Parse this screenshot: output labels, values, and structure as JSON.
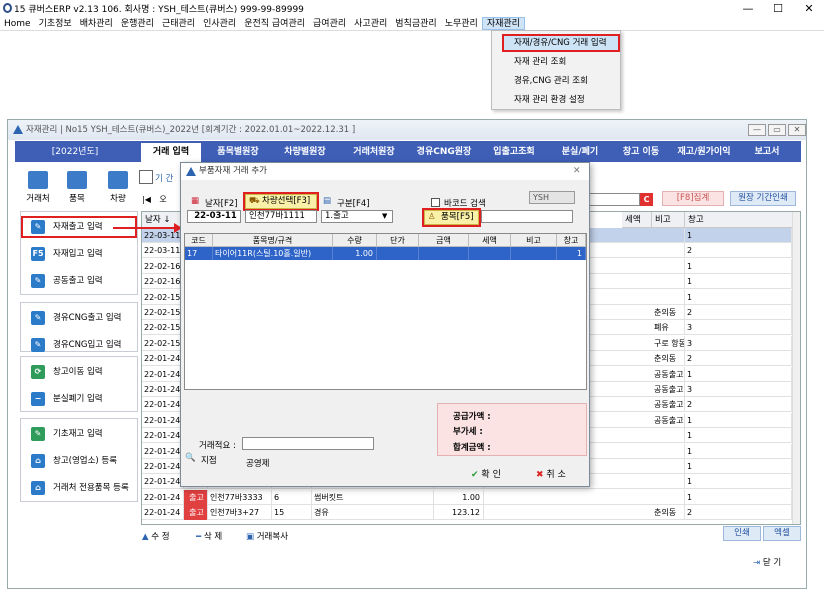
{
  "app": {
    "title": "15 큐버스ERP v2.13  106. 회사명 : YSH_테스트(큐버스)  999-99-89999",
    "window_buttons": [
      "—",
      "☐",
      "✕"
    ]
  },
  "menu": {
    "items": [
      "Home",
      "기초정보",
      "배차관리",
      "운행관리",
      "근태관리",
      "인사관리",
      "운전직 급여관리",
      "급여관리",
      "사고관리",
      "범칙금관리",
      "노무관리",
      "자재관리"
    ],
    "active_index": 11
  },
  "dropdown": {
    "items": [
      "자재/경유/CNG 거래 입력",
      "자재 관리 조회",
      "경유,CNG 관리 조회",
      "자재 관리 환경 설정"
    ],
    "selected_index": 0
  },
  "main_window": {
    "title": "자재관리 | No15 YSH_테스트(큐버스)_2022년 [회계기간 : 2022.01.01~2022.12.31 ]",
    "buttons": [
      "—",
      "▭",
      "✕"
    ],
    "year_label": "[2022년도]",
    "tabs": [
      "거래 입력",
      "품목별원장",
      "차량별원장",
      "거래처원장",
      "경유CNG원장",
      "입출고조회",
      "분실/폐기",
      "창고 이동",
      "재고/원가이익",
      "보고서"
    ],
    "active_tab": 0,
    "toolbar": [
      {
        "label": "거래처",
        "icon": "building-icon"
      },
      {
        "label": "품목",
        "icon": "box-icon"
      },
      {
        "label": "차량",
        "icon": "home-icon"
      }
    ],
    "period_label": "기 간 ⋮",
    "nav_first": "|◀",
    "nav_other": "오",
    "f8_button": "[F8]집계",
    "ledger_print": "원장 기간인쇄",
    "refresh_icon": "C"
  },
  "side_menu": {
    "group1": [
      {
        "label": "자재출고 입력",
        "icon": "pencil-icon",
        "glyph": "✎",
        "highlight": true
      },
      {
        "label": "자재입고 입력",
        "icon": "f5-icon",
        "glyph": "F5"
      },
      {
        "label": "공동출고 입력",
        "icon": "pencil-icon",
        "glyph": "✎"
      }
    ],
    "group2": [
      {
        "label": "경유CNG출고 입력",
        "icon": "pencil-icon",
        "glyph": "✎"
      },
      {
        "label": "경유CNG입고 입력",
        "icon": "pencil-icon",
        "glyph": "✎"
      }
    ],
    "group3": [
      {
        "label": "창고이동 입력",
        "icon": "refresh-icon",
        "glyph": "⟳",
        "green": true
      },
      {
        "label": "분실폐기 입력",
        "icon": "minus-icon",
        "glyph": "−"
      }
    ],
    "group4": [
      {
        "label": "기초재고 입력",
        "icon": "edit-box-icon",
        "glyph": "✎",
        "green": true
      },
      {
        "label": "창고(영업소) 등록",
        "icon": "home-icon",
        "glyph": "⌂"
      },
      {
        "label": "거래처 전용품목 등록",
        "icon": "home-icon",
        "glyph": "⌂"
      }
    ]
  },
  "bg_table": {
    "headers": [
      "날자 ↓",
      "세액",
      "비고",
      "창고"
    ],
    "rows": [
      {
        "date": "22-03-11",
        "note": "",
        "wh": "1",
        "hl": true
      },
      {
        "date": "22-03-11",
        "note": "",
        "wh": "2"
      },
      {
        "date": "22-02-16",
        "note": "",
        "wh": "1"
      },
      {
        "date": "22-02-16",
        "note": "",
        "wh": "1"
      },
      {
        "date": "22-02-15",
        "note": "",
        "wh": "1"
      },
      {
        "date": "22-02-15",
        "note": "춘의동",
        "wh": "2"
      },
      {
        "date": "22-02-15",
        "note": "폐유",
        "wh": "3"
      },
      {
        "date": "22-02-15",
        "note": "구로 항동",
        "wh": "3"
      },
      {
        "date": "22-01-24",
        "note": "춘의동",
        "wh": "2"
      },
      {
        "date": "22-01-24",
        "note": "공동출고",
        "wh": "1"
      },
      {
        "date": "22-01-24",
        "note": "공동출고",
        "wh": "3"
      },
      {
        "date": "22-01-24",
        "note": "공동출고",
        "wh": "2"
      },
      {
        "date": "22-01-24",
        "note": "공동출고",
        "wh": "1"
      },
      {
        "date": "22-01-24",
        "note": "",
        "wh": "1"
      },
      {
        "date": "22-01-24",
        "note": "",
        "wh": "1"
      },
      {
        "date": "22-01-24",
        "note": "",
        "wh": "1"
      },
      {
        "date": "22-01-24",
        "note": "",
        "wh": "1"
      },
      {
        "date": "22-01-24",
        "type": "출고",
        "car": "인천77바3333",
        "code": "6",
        "item": "썸버킷트",
        "amt": "1.00",
        "note": "",
        "wh": "1"
      },
      {
        "date": "22-01-24",
        "type": "출고",
        "car": "인천7바3+27",
        "code": "15",
        "item": "경유",
        "amt": "123.12",
        "note": "춘의동",
        "wh": "2"
      }
    ]
  },
  "bottom": {
    "edit": "수 정",
    "delete": "삭 제",
    "copy": "거래복사",
    "print": "인쇄",
    "excel": "엑셀",
    "close": "닫 기"
  },
  "dialog": {
    "title": "부품자재 거래 추가",
    "close": "✕",
    "date_label": "날자[F2]",
    "date_value": "22-03-11",
    "vehicle_btn": "차량선택[F3]",
    "vehicle_value": "인천77바1111",
    "category_label": "구분[F4]",
    "category_value": "1.출고",
    "barcode_label": "바코드 검색",
    "user_tag": "YSH",
    "item_btn": "품목[F5]",
    "grid_headers": [
      "코드",
      "품목명/규격",
      "수량",
      "단가",
      "금액",
      "세액",
      "비고",
      "창고"
    ],
    "grid_row": {
      "code": "17",
      "name": "타이어11R(스틸.10홀.일반)",
      "qty": "1.00",
      "price": "",
      "amount": "",
      "tax": "",
      "note": "",
      "wh": "1"
    },
    "supply_label": "공급가액 :",
    "vat_label": "부가세 :",
    "total_label": "합계금액 :",
    "memo_label": "거래적요 :",
    "branch_label": "지점",
    "branch_value": "공영제",
    "ok": "확 인",
    "cancel": "취 소"
  }
}
